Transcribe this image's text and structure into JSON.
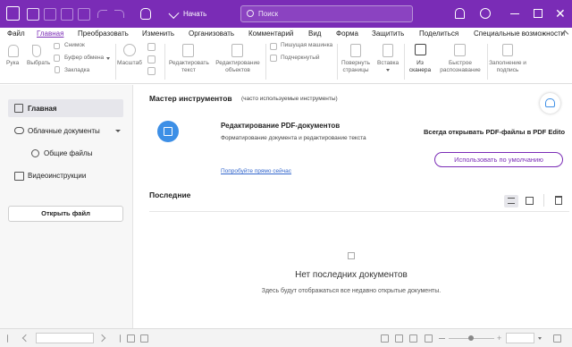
{
  "titlebar": {
    "start_label": "Начать",
    "search_placeholder": "Поиск"
  },
  "menu": [
    "Файл",
    "Главная",
    "Преобразовать",
    "Изменить",
    "Организовать",
    "Комментарий",
    "Вид",
    "Форма",
    "Защитить",
    "Поделиться",
    "Специальные возможности"
  ],
  "ribbon": {
    "hand": "Рука",
    "select": "Выбрать",
    "snapshot": "Снимок",
    "clipboard": "Буфер обмена",
    "bookmark": "Закладка",
    "zoom": "Масштаб",
    "edit_text": "Редактировать текст",
    "edit_objects": "Редактирование объектов",
    "typewriter": "Пишущая машинка",
    "highlight": "Подчеркнутый",
    "rotate_pages": "Повернуть страницы",
    "insert": "Вставка",
    "from_scanner": "Из сканера",
    "ocr": "Быстрое распознавание",
    "fill_sign": "Заполнение и подпись"
  },
  "sidebar": {
    "home": "Главная",
    "cloud": "Облачные документы",
    "shared": "Общие файлы",
    "video": "Видеоинструкции",
    "open_file": "Открыть файл"
  },
  "main": {
    "wizard_title": "Мастер инструментов",
    "wizard_subtitle": "(часто используемые инструменты)",
    "tool_title": "Редактирование PDF-документов",
    "tool_desc": "Форматирование документа и редактирование текста",
    "try_link": "Попробуйте прямо сейчас",
    "always_open": "Всегда открывать PDF-файлы в PDF Edito",
    "default_button": "Использовать по умолчанию",
    "recent_title": "Последние",
    "empty_title": "Нет последних документов",
    "empty_desc": "Здесь будут отображаться все недавно открытые документы."
  },
  "colors": {
    "brand": "#7a2cb6",
    "accent_blue": "#3d8fe6",
    "link": "#3366cc"
  }
}
